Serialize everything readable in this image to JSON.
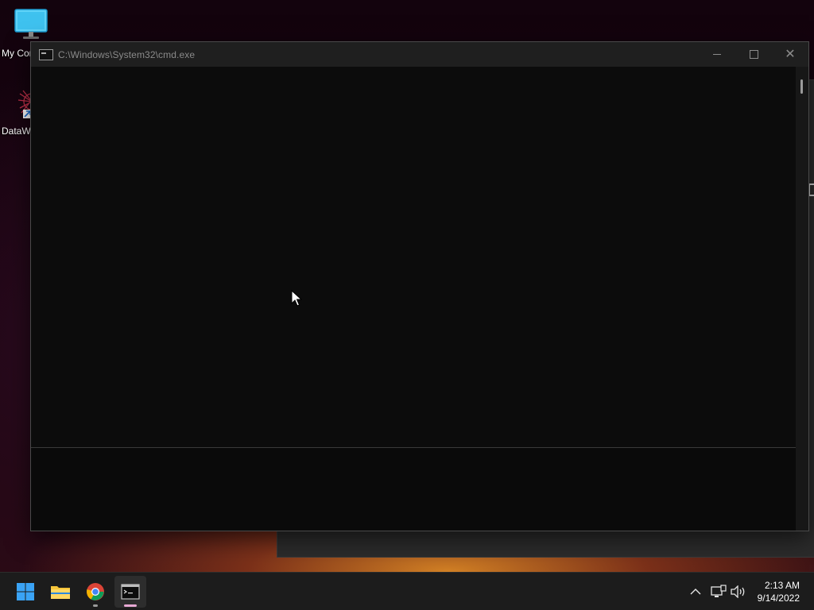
{
  "desktop": {
    "icons": [
      {
        "label": "My Computer",
        "icon": "monitor-icon"
      },
      {
        "label": "DataWarrior",
        "icon": "datawarrior-app-icon"
      }
    ]
  },
  "cmd_window": {
    "title": "C:\\Windows\\System32\\cmd.exe",
    "icon": "console-icon",
    "controls": {
      "minimize": "minimize-icon",
      "maximize": "maximize-icon",
      "close": "close-icon"
    }
  },
  "taskbar": {
    "apps": [
      {
        "name": "Start",
        "icon": "windows-start-icon"
      },
      {
        "name": "File Explorer",
        "icon": "folder-icon"
      },
      {
        "name": "Google Chrome",
        "icon": "chrome-icon"
      },
      {
        "name": "Command Prompt",
        "icon": "console-icon",
        "active": true
      }
    ],
    "tray": {
      "overflow_icon": "chevron-up-icon",
      "network_icon": "network-icon",
      "volume_icon": "volume-icon"
    },
    "clock": {
      "time": "2:13 AM",
      "date": "9/14/2022"
    }
  },
  "colors": {
    "console_bg": "#0c0c0c",
    "titlebar_bg": "#1f1f1f",
    "taskbar_bg": "#1c1c1c"
  }
}
